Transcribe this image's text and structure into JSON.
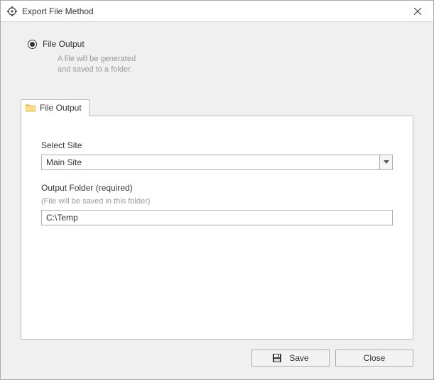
{
  "window": {
    "title": "Export File Method"
  },
  "option": {
    "label": "File Output",
    "description_line1": "A file will be generated",
    "description_line2": "and saved to a folder."
  },
  "tab": {
    "label": "File Output"
  },
  "form": {
    "site_label": "Select Site",
    "site_value": "Main Site",
    "folder_label": "Output Folder (required)",
    "folder_hint": "(File will be saved in this folder)",
    "folder_value": "C:\\Temp"
  },
  "buttons": {
    "save": "Save",
    "close": "Close"
  }
}
